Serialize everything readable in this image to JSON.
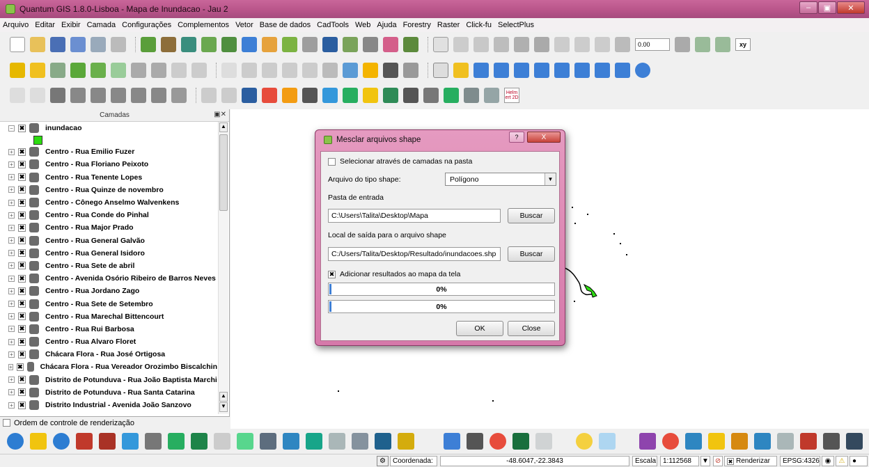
{
  "window": {
    "title": "Quantum GIS 1.8.0-Lisboa - Mapa de Inundacao - Jau 2"
  },
  "menu": [
    "Arquivo",
    "Editar",
    "Exibir",
    "Camada",
    "Configurações",
    "Complementos",
    "Vetor",
    "Base de dados",
    "CadTools",
    "Web",
    "Ajuda",
    "Forestry",
    "Raster",
    "Click-fu",
    "SelectPlus"
  ],
  "toolbar": {
    "scale_input": "0.00",
    "xy_label": "xy",
    "helm_label": "Helm ert 2D"
  },
  "layers_panel": {
    "title": "Camadas",
    "items": [
      "inundacao",
      "Centro - Rua Emilio Fuzer",
      "Centro - Rua Floriano Peixoto",
      "Centro - Rua Tenente Lopes",
      "Centro - Rua Quinze de novembro",
      "Centro - Cônego Anselmo Walvenkens",
      "Centro - Rua Conde do Pinhal",
      "Centro - Rua Major Prado",
      "Centro - Rua General Galvão",
      "Centro - Rua General Isidoro",
      "Centro - Rua Sete de abril",
      "Centro - Avenida Osório Ribeiro de Barros Neves",
      "Centro - Rua Jordano Zago",
      "Centro - Rua Sete de Setembro",
      "Centro - Rua Marechal Bittencourt",
      "Centro - Rua Rui Barbosa",
      "Centro - Rua Alvaro Floret",
      "Chácara Flora - Rua José Ortigosa",
      "Chácara Flora - Rua Vereador Orozimbo Biscalchin",
      "Distrito de Potunduva - Rua João Baptista Marchi",
      "Distrito de Potunduva - Rua Santa Catarina",
      "Distrito Industrial - Avenida João Sanzovo"
    ],
    "render_order_label": "Ordem de controle de renderização"
  },
  "dialog": {
    "title": "Mesclar arquivos shape",
    "help": "?",
    "close": "X",
    "select_by_folder_label": "Selecionar através de camadas na pasta",
    "shape_type_label": "Arquivo do tipo shape:",
    "shape_type_value": "Polígono",
    "input_folder_label": "Pasta de entrada",
    "input_folder_value": "C:\\Users\\Talita\\Desktop\\Mapa",
    "browse_label": "Buscar",
    "output_label": "Local de saída para o arquivo shape",
    "output_value": "C:/Users/Talita/Desktop/Resultado/inundacoes.shp",
    "add_results_label": "Adicionar resultados ao mapa da tela",
    "progress1": "0%",
    "progress2": "0%",
    "progress1_value": 0.0,
    "progress2_value": 0.0,
    "ok_label": "OK",
    "close_label": "Close"
  },
  "statusbar": {
    "coord_label": "Coordenada:",
    "coord_value": "-48.6047,-22.3843",
    "scale_label": "Escala",
    "scale_value": "1:112568",
    "render_label": "Renderizar",
    "epsg": "EPSG:4326"
  },
  "colors": {
    "title_accent": "#c9669a",
    "layer_swatch": "#2ddc11",
    "progress": "#3d7fd6"
  }
}
